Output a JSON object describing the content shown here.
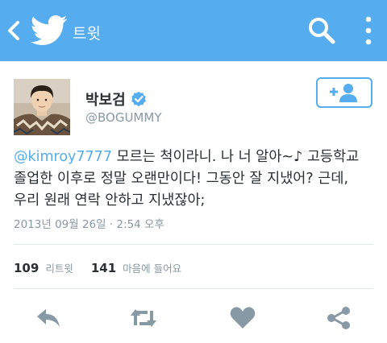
{
  "topbar": {
    "title": "트윗",
    "back_icon": "chevron-left-icon",
    "bird_icon": "twitter-bird-icon",
    "search_icon": "search-icon",
    "more_icon": "vertical-ellipsis-icon",
    "color": "#55acee"
  },
  "user": {
    "name": "박보검",
    "handle": "@BOGUMMY",
    "verified": true,
    "follow_icon": "add-user-icon"
  },
  "tweet": {
    "mention": "@kimroy7777",
    "line1_rest": " 모르는 척이라니. 나 너 알아~♪ 고등학교",
    "line2": "졸업한 이후로 정말 오랜만이다! 그동안 잘 지냈어? 근데,",
    "line3": "우리 원래 연락 안하고 지냈잖아;",
    "timestamp": "2013년 09월 26일 · 2:54 오후"
  },
  "stats": {
    "retweets": "109",
    "retweets_label": "리트윗",
    "likes": "141",
    "likes_label": "마음에 들어요"
  },
  "actions": {
    "reply_icon": "reply-icon",
    "retweet_icon": "retweet-icon",
    "like_icon": "heart-icon",
    "share_icon": "share-icon",
    "icon_color": "#8899a6"
  }
}
